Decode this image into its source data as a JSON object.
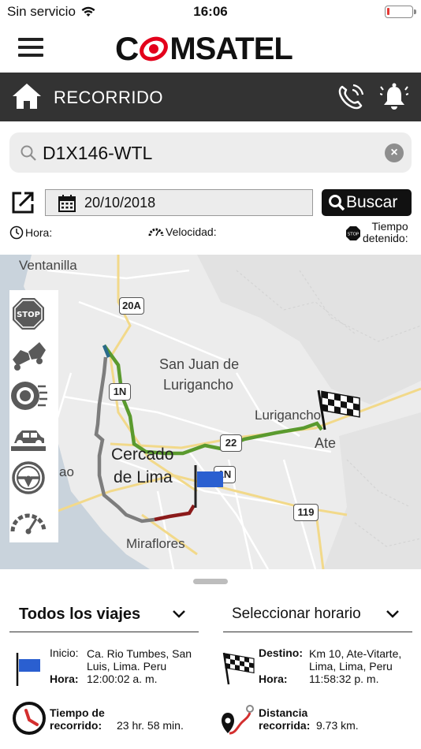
{
  "status": {
    "carrier": "Sin servicio",
    "time": "16:06"
  },
  "nav": {
    "title": "RECORRIDO"
  },
  "logo": {
    "text_a": "C",
    "text_b": "MSATEL"
  },
  "search": {
    "value": "D1X146-WTL",
    "clear": "×"
  },
  "date": {
    "value": "20/10/2018"
  },
  "buscar": {
    "label": "Buscar"
  },
  "info": {
    "hora": "Hora:",
    "velocidad": "Velocidad:",
    "tiempo_l1": "Tiempo",
    "tiempo_l2": "detenido:"
  },
  "map": {
    "labels": {
      "ventanilla": "Ventanilla",
      "sjl_l1": "San Juan de",
      "sjl_l2": "Lurigancho",
      "lurigancho": "Lurigancho",
      "ate": "Ate",
      "cercado_l1": "Cercado",
      "cercado_l2": "de Lima",
      "callao": "ao",
      "miraflores": "Miraflores"
    },
    "shields": {
      "r20a": "20A",
      "r1n_a": "1N",
      "r1n_b": "1N",
      "r22": "22",
      "r119": "119"
    },
    "tools": [
      "stop-icon",
      "crash-icon",
      "brake-icon",
      "vehicle-icon",
      "steering-icon",
      "speedometer-icon"
    ]
  },
  "selectors": {
    "viajes": "Todos los viajes",
    "horario": "Seleccionar horario"
  },
  "trip": {
    "inicio_label": "Inicio:",
    "inicio_l1": "Ca. Rio Tumbes, San",
    "inicio_l2": "Luis, Lima. Peru",
    "hora_label": "Hora:",
    "inicio_hora": "12:00:02 a. m.",
    "destino_label": "Destino:",
    "destino_l1": "Km 10, Ate-Vitarte,",
    "destino_l2": "Lima, Lima, Peru",
    "destino_hora": "11:58:32 p. m.",
    "tiempo_label_l1": "Tiempo de",
    "tiempo_label_l2": "recorrido:",
    "tiempo_value": "23 hr. 58 min.",
    "distancia_label_l1": "Distancia",
    "distancia_label_l2": "recorrida:",
    "distancia_value": "9.73 km."
  },
  "colors": {
    "navbar": "#333333",
    "route_green": "#5a9a2e",
    "route_gray": "#7d7d7d",
    "route_red": "#8b1a1a",
    "flag_blue": "#2a5fd0",
    "logo_red": "#e3001b"
  }
}
